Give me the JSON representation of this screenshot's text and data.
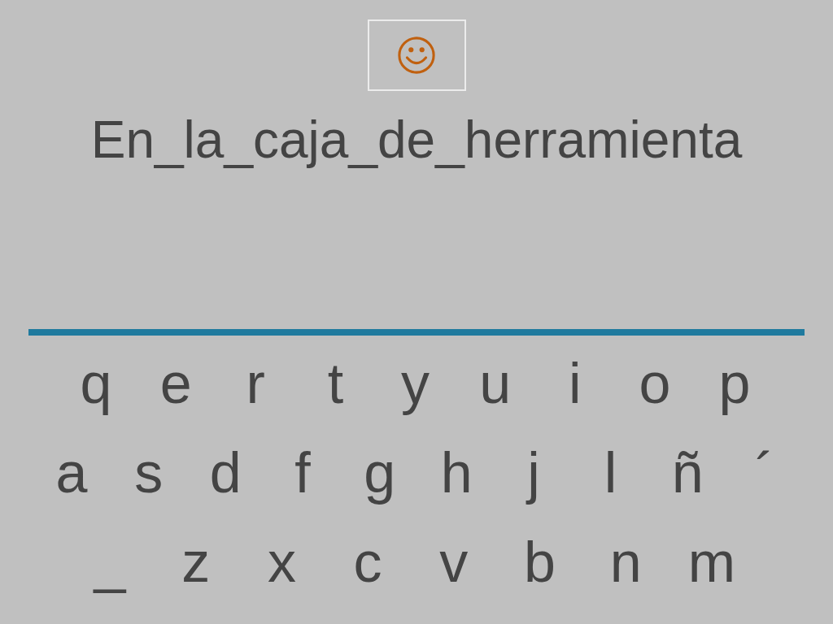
{
  "feedback": {
    "kind": "smiley"
  },
  "prompt": "En_la_caja_de_herramienta",
  "keyboard": {
    "rows": [
      [
        "q",
        "e",
        "r",
        "t",
        "y",
        "u",
        "i",
        "o",
        "p"
      ],
      [
        "a",
        "s",
        "d",
        "f",
        "g",
        "h",
        "j",
        "l",
        "ñ",
        "´"
      ],
      [
        "_",
        "z",
        "x",
        "c",
        "v",
        "b",
        "n",
        "m"
      ]
    ]
  }
}
